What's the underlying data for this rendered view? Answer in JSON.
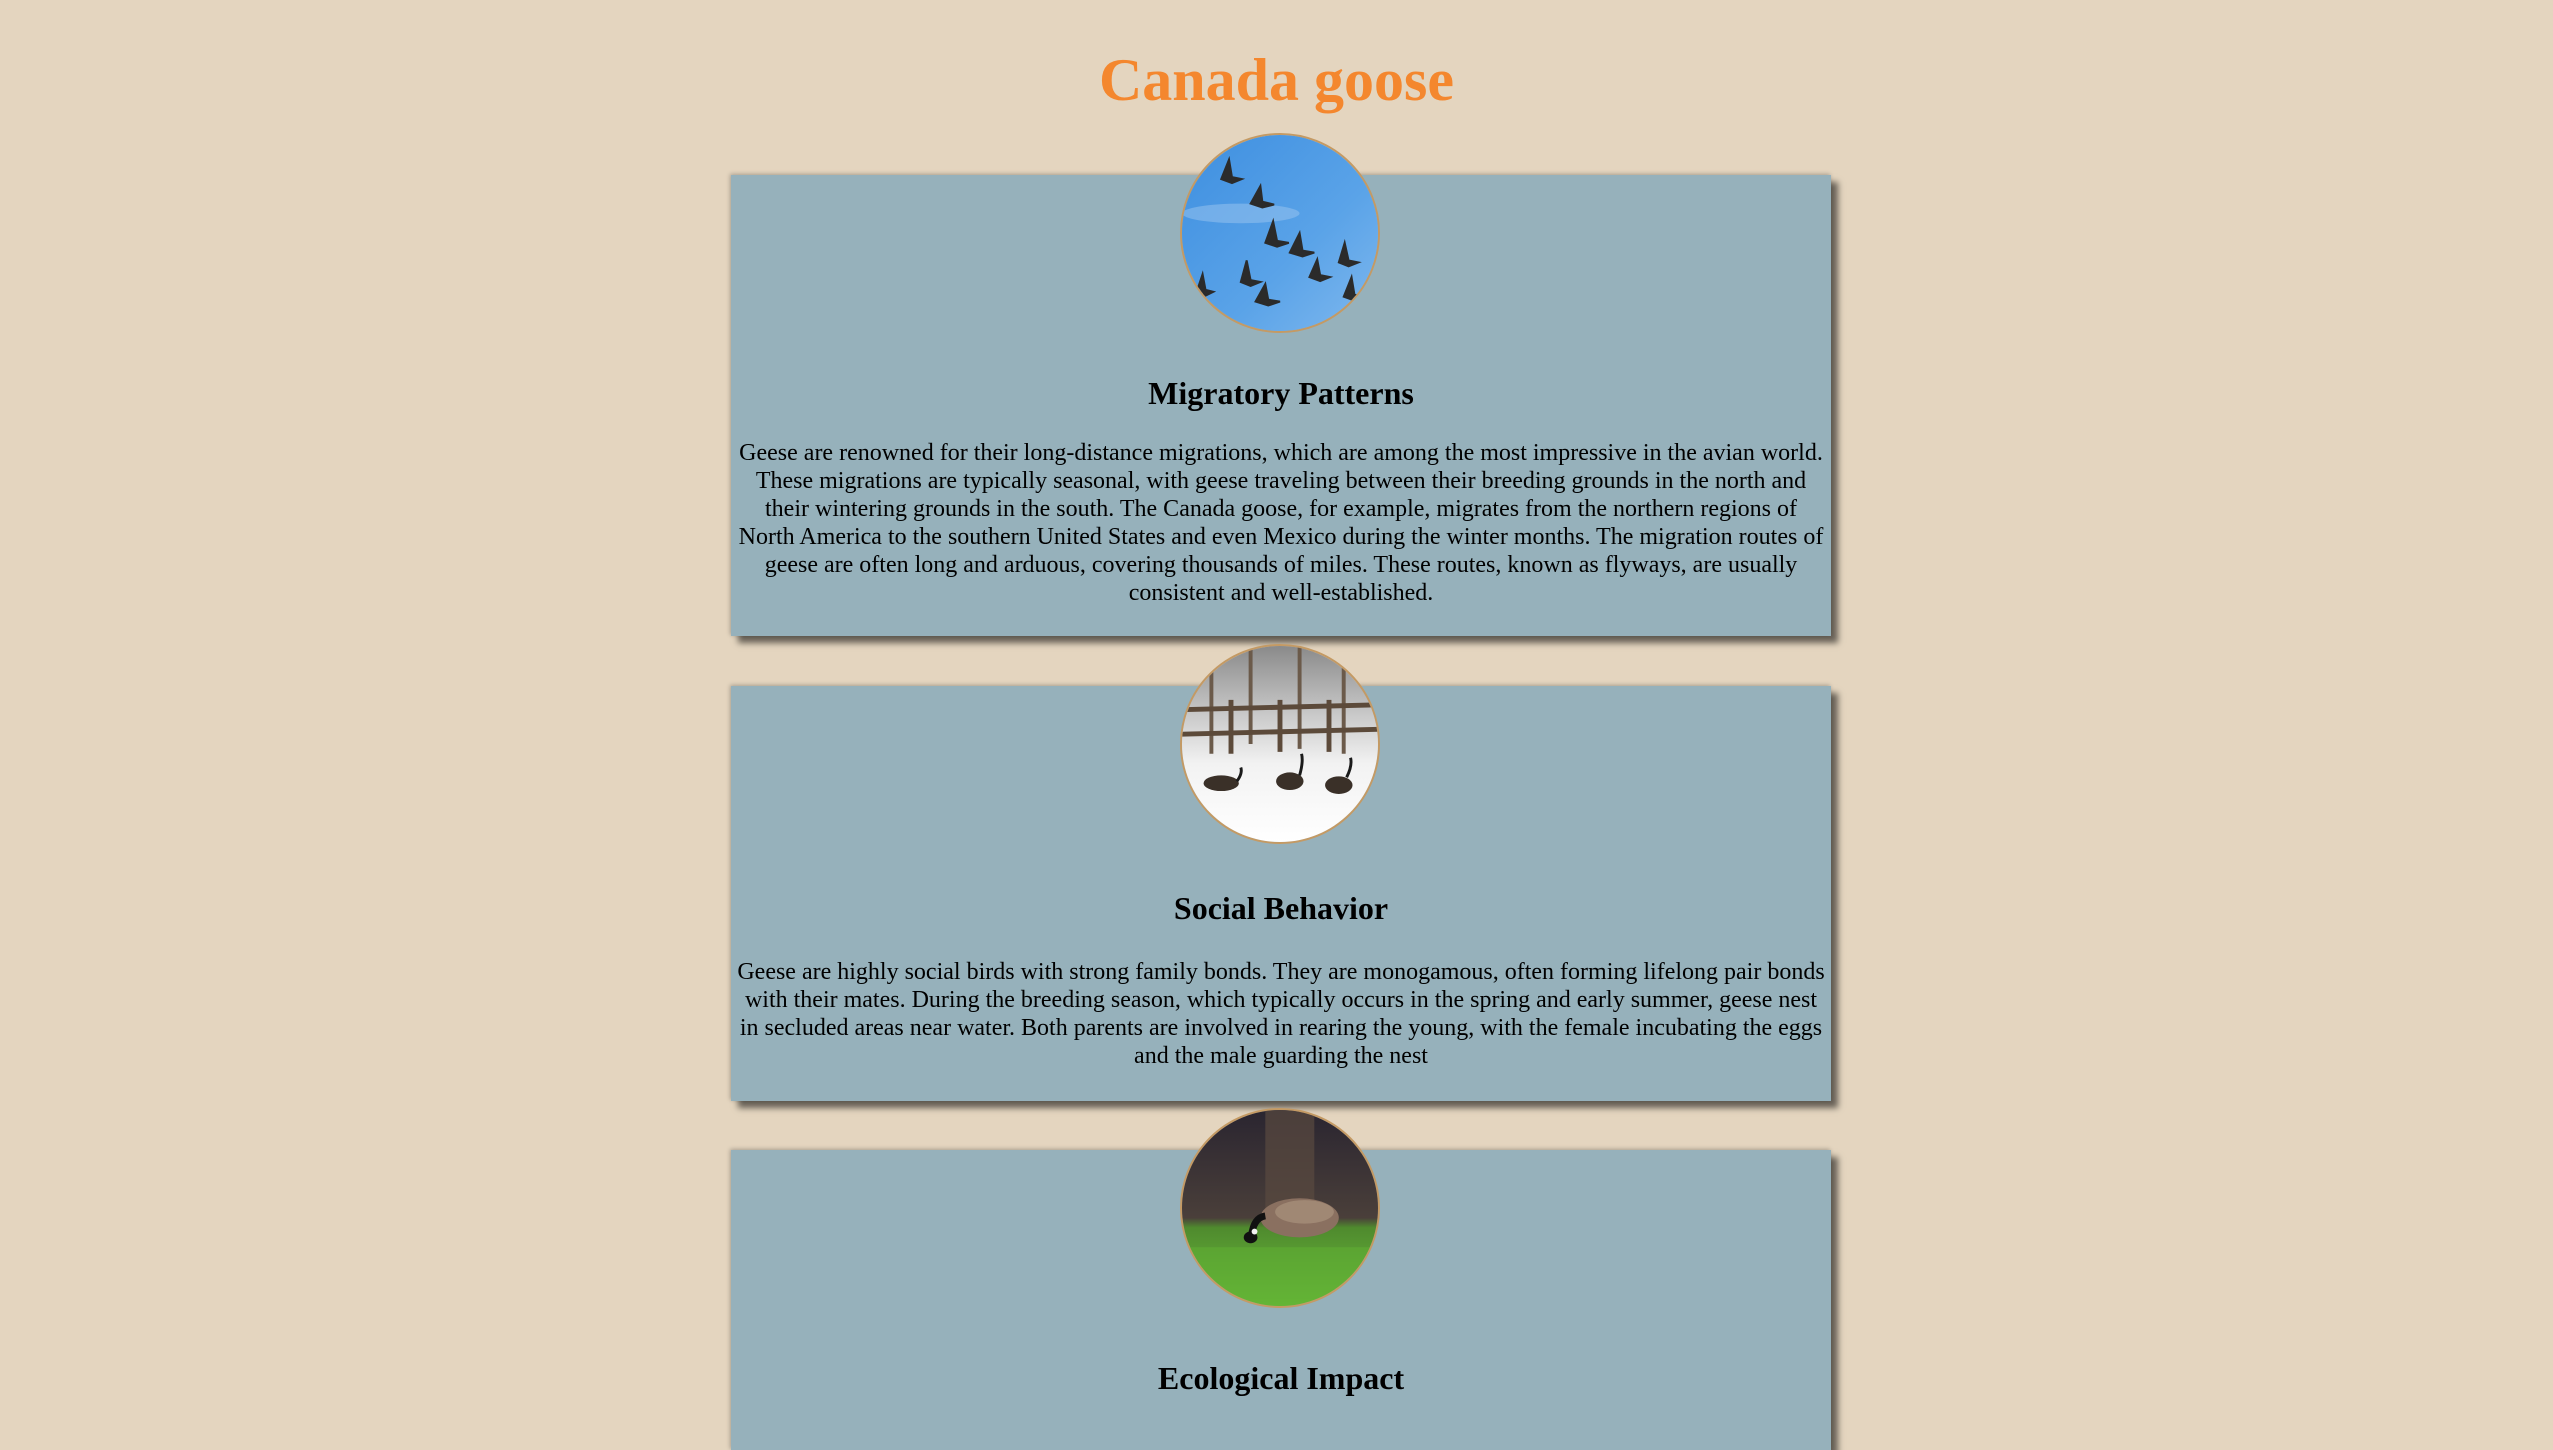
{
  "page": {
    "title": "Canada goose",
    "title_color": "#f4872e",
    "background_color": "#e4d5bf",
    "card_color": "#96b1bb"
  },
  "sections": [
    {
      "heading": "Migratory Patterns",
      "image_icon": "geese-flying-sky-photo",
      "text": "Geese are renowned for their long-distance migrations, which are among the most impressive in the avian world. These migrations are typically seasonal, with geese traveling between their breeding grounds in the north and their wintering grounds in the south. The Canada goose, for example, migrates from the northern regions of North America to the southern United States and even Mexico during the winter months. The migration routes of geese are often long and arduous, covering thousands of miles. These routes, known as flyways, are usually consistent and well-established."
    },
    {
      "heading": "Social Behavior",
      "image_icon": "geese-in-snow-photo",
      "text": "Geese are highly social birds with strong family bonds. They are monogamous, often forming lifelong pair bonds with their mates. During the breeding season, which typically occurs in the spring and early summer, geese nest in secluded areas near water. Both parents are involved in rearing the young, with the female incubating the eggs and the male guarding the nest"
    },
    {
      "heading": "Ecological Impact",
      "image_icon": "goose-grazing-grass-photo"
    }
  ]
}
